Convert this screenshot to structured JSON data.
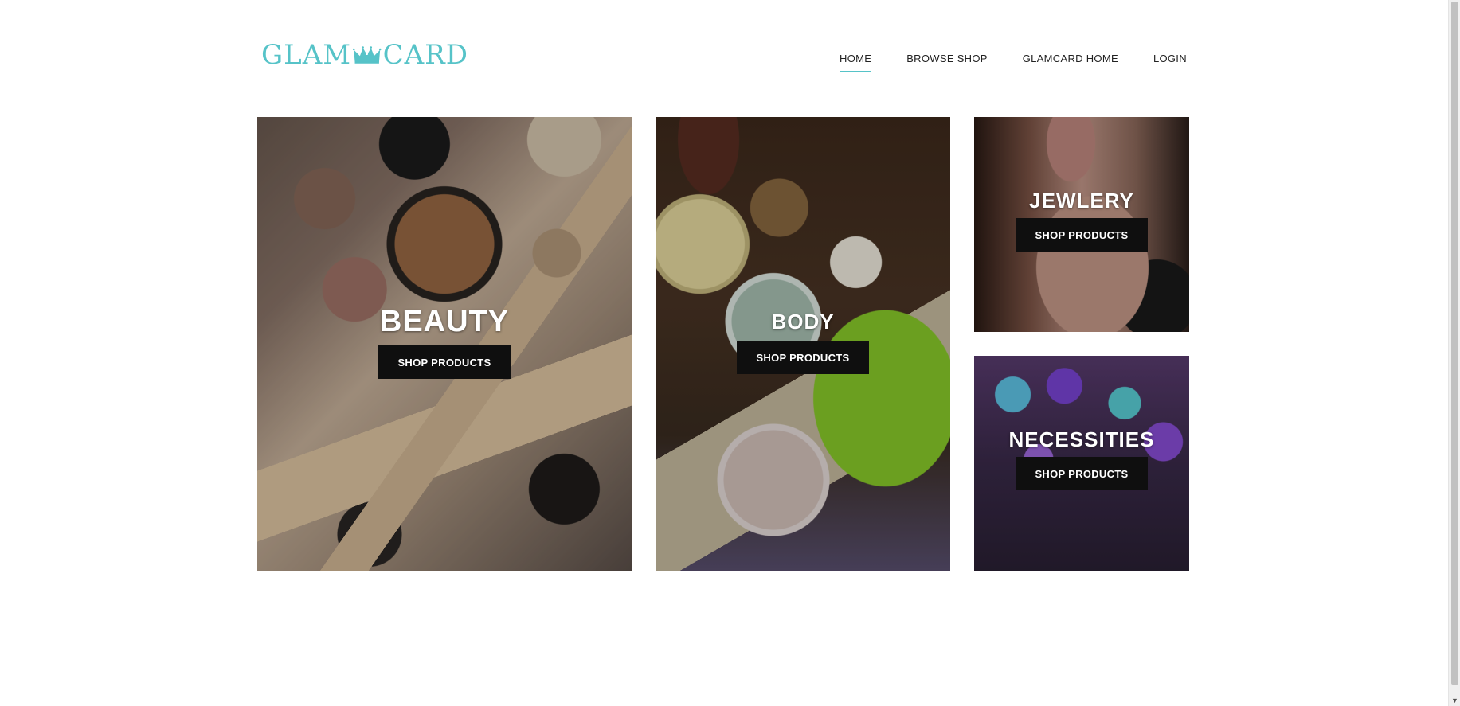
{
  "logo": {
    "left_text": "GLAM",
    "right_text": "CARD",
    "icon": "crown-icon",
    "color": "#56c3c8"
  },
  "nav": {
    "items": [
      {
        "label": "HOME",
        "active": true
      },
      {
        "label": "BROWSE SHOP",
        "active": false
      },
      {
        "label": "GLAMCARD HOME",
        "active": false
      },
      {
        "label": "LOGIN",
        "active": false
      }
    ],
    "accent": "#56c3c8"
  },
  "tiles": [
    {
      "title": "BEAUTY",
      "button": "SHOP PRODUCTS"
    },
    {
      "title": "BODY",
      "button": "SHOP PRODUCTS"
    },
    {
      "title": "JEWLERY",
      "button": "SHOP PRODUCTS"
    },
    {
      "title": "NECESSITIES",
      "button": "SHOP PRODUCTS"
    }
  ],
  "scrollbar": {
    "arrow_icon": "scroll-down-arrow-icon"
  }
}
